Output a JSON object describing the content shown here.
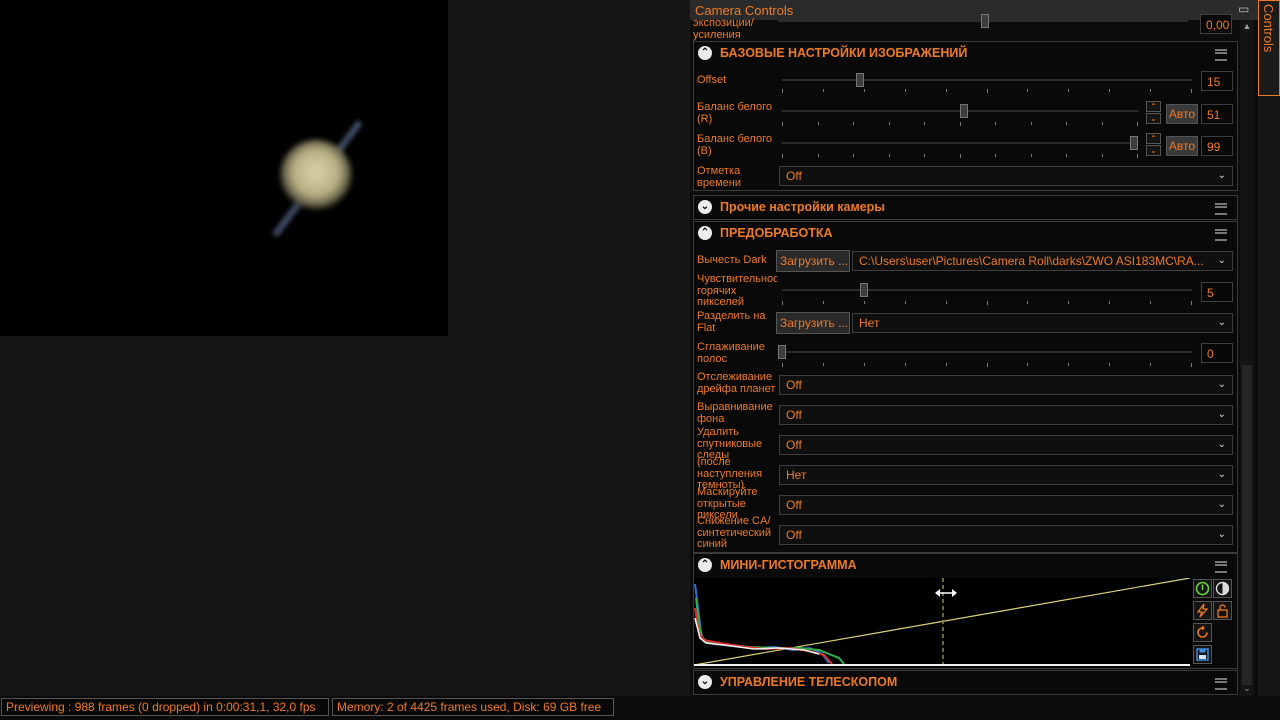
{
  "panel": {
    "title": "Camera Controls",
    "side_tab": "Camera Controls"
  },
  "top_row": {
    "label": "экспозиции/\nусиления",
    "value": "0,00",
    "level": 0.5
  },
  "basic": {
    "title": "БАЗОВЫЕ НАСТРОЙКИ ИЗОБРАЖЕНИЙ",
    "offset": {
      "label": "Offset",
      "value": "15",
      "level": 0.19
    },
    "wb_r": {
      "label": "Баланс белого (R)",
      "auto": "Авто",
      "value": "51",
      "level": 0.51
    },
    "wb_b": {
      "label": "Баланс белого (B)",
      "auto": "Авто",
      "value": "99",
      "level": 0.99
    },
    "timestamp": {
      "label": "Отметка времени",
      "value": "Off"
    }
  },
  "other": {
    "title": "Прочие настройки камеры"
  },
  "pre": {
    "title": "ПРЕДОБРАБОТКА",
    "dark": {
      "label": "Вычесть Dark",
      "button": "Загрузить ...",
      "value": "C:\\Users\\user\\Pictures\\Camera Roll\\darks\\ZWO ASI183MC\\RA..."
    },
    "hot": {
      "label": "Чувствительность горячих пикселей",
      "value": "5",
      "level": 0.2
    },
    "flat": {
      "label": "Разделить на Flat",
      "button": "Загрузить ...",
      "value": "Нет"
    },
    "smooth": {
      "label": "Сглаживание полос",
      "value": "0",
      "level": 0.0
    },
    "drift": {
      "label": "Отслеживание дрейфа планет",
      "value": "Off"
    },
    "bg": {
      "label": "Выравнивание фона",
      "value": "Off"
    },
    "sat": {
      "label": "Удалить спутниковые следы",
      "value": "Off"
    },
    "dark_after": {
      "label": "(после наступления темноты)",
      "value": "Нет"
    },
    "mask": {
      "label": "Маскируйте открытые пиксели",
      "value": "Off"
    },
    "ca": {
      "label": "Снижение CA/ синтетический синий",
      "value": "Off"
    }
  },
  "histogram": {
    "title": "МИНИ-ГИСТОГРАММА"
  },
  "telescope": {
    "title": "УПРАВЛЕНИЕ ТЕЛЕСКОПОМ"
  },
  "status": {
    "preview": "Previewing : 988 frames (0 dropped) in 0:00:31,1, 32,0 fps",
    "memory": "Memory: 2 of 4425 frames used, Disk: 69 GB free"
  },
  "colors": {
    "accent": "#ee7a23",
    "background": "#161616",
    "panel": "#0c0c0c"
  }
}
